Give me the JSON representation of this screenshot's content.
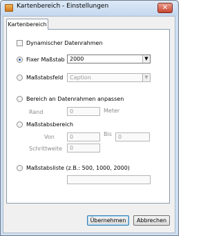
{
  "window": {
    "title": "Kartenbereich - Einstellungen",
    "close_glyph": "✕"
  },
  "tabs": [
    {
      "label": "Kartenbereich",
      "selected": true
    }
  ],
  "options": {
    "dynamic_frame": {
      "label": "Dynamischer Datenrahmen",
      "checked": false
    },
    "fixed_scale": {
      "label": "Fixer Maßstab",
      "selected": true,
      "value": "2000"
    },
    "scale_field": {
      "label": "Maßstabsfeld",
      "selected": false,
      "value": "Caption"
    },
    "fit_to_frame": {
      "label": "Bereich an Datenrahmen anpassen",
      "selected": false,
      "rand_label": "Rand",
      "rand_value": "0",
      "unit_label": "Meter"
    },
    "scale_range": {
      "label": "Maßstabsbereich",
      "selected": false,
      "from_label": "Von",
      "from_value": "0",
      "to_label": "Bis",
      "to_value": "0",
      "step_label": "Schrittweite",
      "step_value": "0"
    },
    "scale_list": {
      "label": "Maßstabsliste (z.B.: 500, 1000, 2000)",
      "selected": false,
      "value": ""
    }
  },
  "buttons": {
    "apply": "Übernehmen",
    "cancel": "Abbrechen"
  },
  "icons": {
    "dropdown_arrow": "▼"
  },
  "colors": {
    "title_bar": "#c4d8ef",
    "close_button": "#c8442f",
    "dialog_bg": "#f0f0f0",
    "radio_dot": "#1a4f98"
  }
}
